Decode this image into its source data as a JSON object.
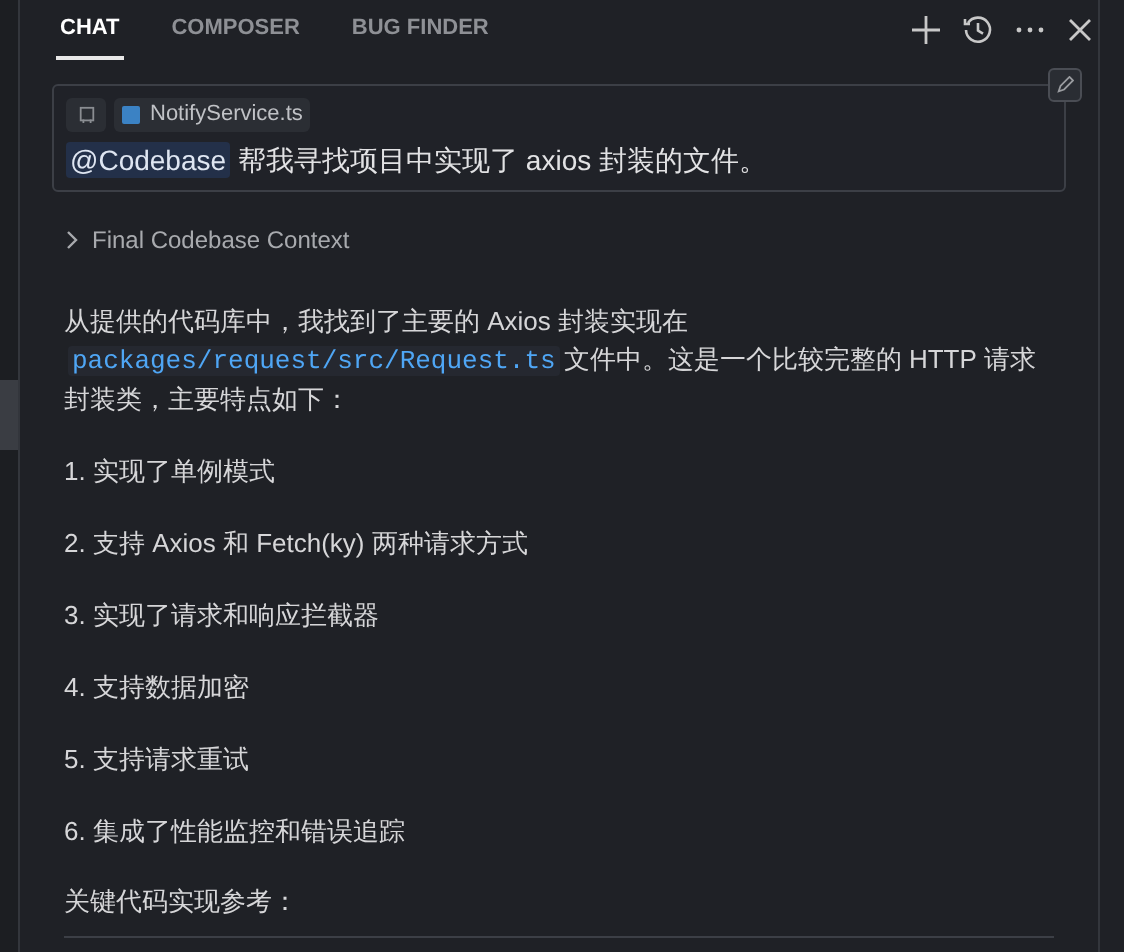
{
  "tabs": [
    {
      "label": "CHAT",
      "selected": true
    },
    {
      "label": "COMPOSER",
      "selected": false
    },
    {
      "label": "BUG FINDER",
      "selected": false
    }
  ],
  "message": {
    "file_chip": "NotifyService.ts",
    "mention": "@Codebase",
    "text": "帮我寻找项目中实现了 axios 封装的文件。"
  },
  "context_section": {
    "label": "Final Codebase Context",
    "expanded": false
  },
  "response": {
    "paragraph": [
      {
        "kind": "text",
        "text": "从提供的代码库中，我找到了主要的 Axios 封装实现在"
      },
      {
        "kind": "code",
        "text": "packages/request/src/Request.ts"
      },
      {
        "kind": "text",
        "text": "文件中。这是一个比较完整的 HTTP 请求封装类，主要特点如下："
      }
    ],
    "list": [
      "1. 实现了单例模式",
      "2. 支持 Axios 和 Fetch(ky) 两种请求方式",
      "3. 实现了请求和响应拦截器",
      "4. 支持数据加密",
      "5. 支持请求重试",
      "6. 集成了性能监控和错误追踪"
    ],
    "footer": "关键代码实现参考："
  }
}
